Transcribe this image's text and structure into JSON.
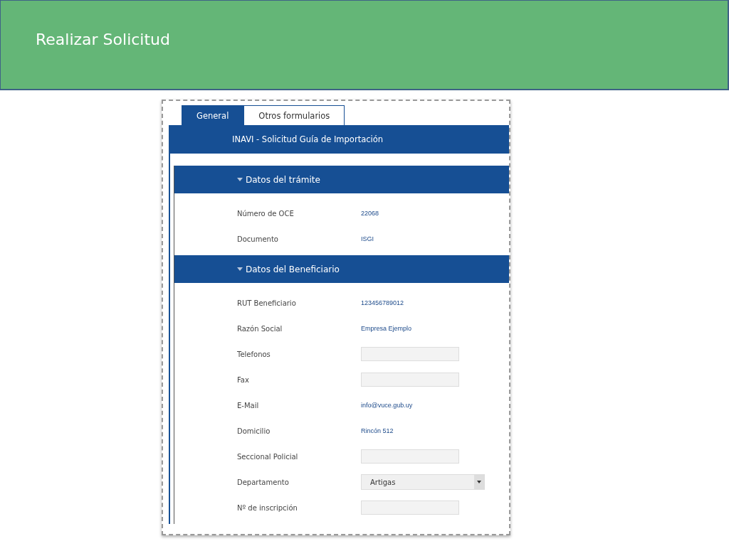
{
  "slide_title": "Realizar Solicitud",
  "tabs": [
    {
      "label": "General",
      "selected": true
    },
    {
      "label": "Otros formularios",
      "selected": false
    }
  ],
  "form_title": "INAVI - Solicitud Guía de Importación",
  "sections": [
    {
      "title": "Datos del trámite",
      "expanded": true,
      "fields": [
        {
          "kind": "text",
          "label": "Número de OCE",
          "value": "22068"
        },
        {
          "kind": "text",
          "label": "Documento",
          "value": "ISGI"
        }
      ]
    },
    {
      "title": "Datos del Beneficiario",
      "expanded": true,
      "fields": [
        {
          "kind": "text",
          "label": "RUT Beneficiario",
          "value": "123456789012"
        },
        {
          "kind": "text",
          "label": "Razón Social",
          "value": "Empresa Ejemplo"
        },
        {
          "kind": "input",
          "label": "Telefonos"
        },
        {
          "kind": "input",
          "label": "Fax"
        },
        {
          "kind": "text",
          "label": "E-Mail",
          "value": "info@vuce.gub.uy"
        },
        {
          "kind": "text",
          "label": "Domicilio",
          "value": "Rincón 512"
        },
        {
          "kind": "input",
          "label": "Seccional Policial"
        },
        {
          "kind": "select",
          "label": "Departamento",
          "value": "Artigas"
        },
        {
          "kind": "input",
          "label": "Nº de inscripción"
        }
      ]
    }
  ]
}
